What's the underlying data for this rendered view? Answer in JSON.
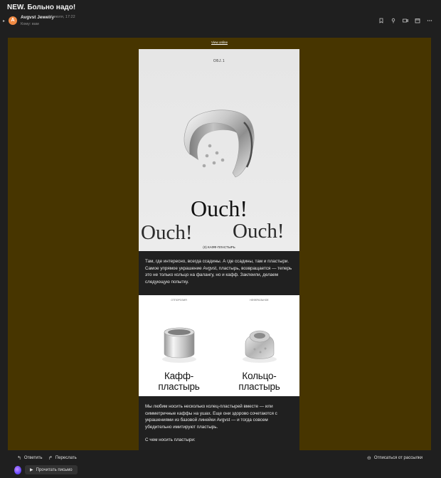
{
  "subject": "NEW. Больно надо!",
  "sender": {
    "avatar_letter": "A",
    "name": "Avgvst Jewelry",
    "date": "6 июля, 17:22",
    "recipient": "Кому: вам"
  },
  "toolbar": {
    "icons": [
      "bookmark-icon",
      "pin-icon",
      "video-icon",
      "calendar-icon",
      "more-icon"
    ]
  },
  "email": {
    "view_online": "View online",
    "hero": {
      "tag": "ОБJ.1",
      "ouch_main": "Ouch!",
      "ouch_left": "Ouch!",
      "ouch_right": "Ouch!",
      "caption": "(II) КАФФ-ПЛАСТЫРЬ"
    },
    "text1": "Там, где интересно, всегда ссадины. А где ссадины, там и пластыри. Самое упрямое украшение Avgvst, пластырь, возвращается — теперь это не только кольцо на фалангу, но и кафф. Заклеили, делаем следующую попытку.",
    "products": [
      {
        "tag": "ОТПОРОЗИЯ",
        "title_line1": "Кафф-",
        "title_line2": "пластырь"
      },
      {
        "tag": "НЕФЕРАЛЬНОЕ",
        "title_line1": "Кольцо-",
        "title_line2": "пластырь"
      }
    ],
    "text2": "Мы любим носить несколько колец-пластырей вместе — или симметричные каффы на ушах. Еще они здорово сочетаются с украшениями из базовой линейки Avgvst — и тогда совсем убедительно имитируют пластырь.",
    "text2_b": "С чем носить пластыри:"
  },
  "actions": {
    "reply": "Ответить",
    "forward": "Переслать",
    "unsubscribe": "Отписаться от рассылки",
    "read_letter": "Прочитать письмо"
  }
}
